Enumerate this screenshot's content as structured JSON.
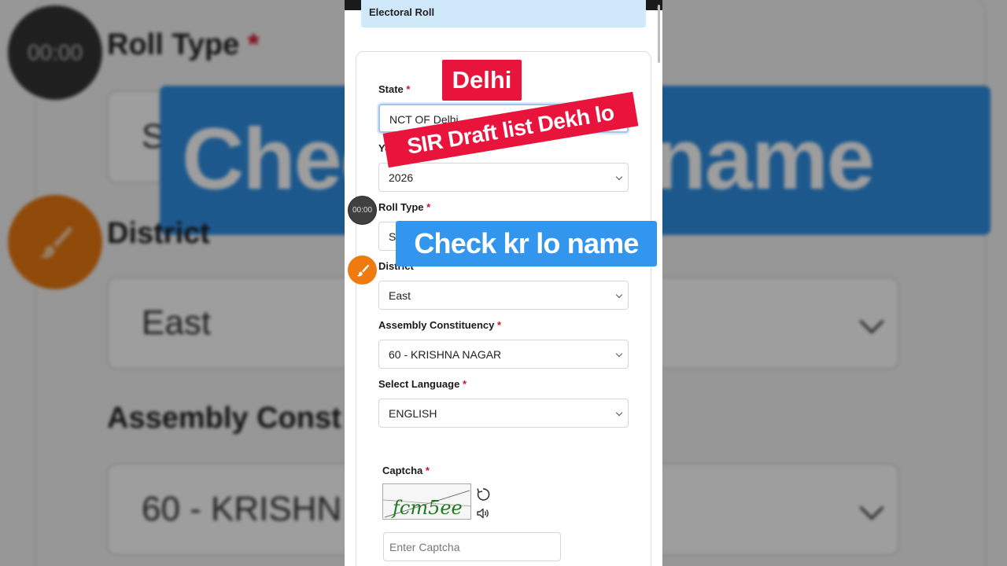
{
  "background": {
    "timer_text": "00:00",
    "roll_type_label": "Roll Type",
    "roll_type_value_fragment": "S",
    "district_label": "District",
    "district_value": "East",
    "assembly_label_fragment": "Assembly Const",
    "assembly_value_fragment": "60 - KRISHN",
    "banner_text": "Check kr lo name"
  },
  "header": {
    "notice_text": "Electoral Roll"
  },
  "form": {
    "required_mark": "*",
    "state": {
      "label": "State",
      "value": "NCT OF Delhi"
    },
    "year": {
      "label": "Ye",
      "value": "2026"
    },
    "roll_type": {
      "label": "Roll Type",
      "value": "S"
    },
    "district": {
      "label": "District",
      "value": "East"
    },
    "assembly": {
      "label": "Assembly Constituency",
      "value": "60 - KRISHNA NAGAR"
    },
    "language": {
      "label": "Select Language",
      "value": "ENGLISH"
    },
    "captcha": {
      "label": "Captcha",
      "image_text": "fcm5ee",
      "input_placeholder": "Enter Captcha"
    }
  },
  "overlay": {
    "timer_text": "00:00",
    "delhi_tag": "Delhi",
    "sir_banner": "SIR Draft list Dekh lo",
    "check_banner": "Check kr lo name"
  },
  "colors": {
    "sticker_red": "#e8143c",
    "sticker_blue": "#3296ee",
    "brush_orange": "#ef7a10",
    "required_red": "#d01028",
    "notice_bg": "#cfe8fa",
    "captcha_green": "#1f7a1f"
  },
  "icons": {
    "timer": "timer-icon",
    "brush": "brush-icon",
    "refresh": "refresh-icon",
    "audio": "speaker-icon",
    "dropdown": "chevron-down-icon"
  }
}
